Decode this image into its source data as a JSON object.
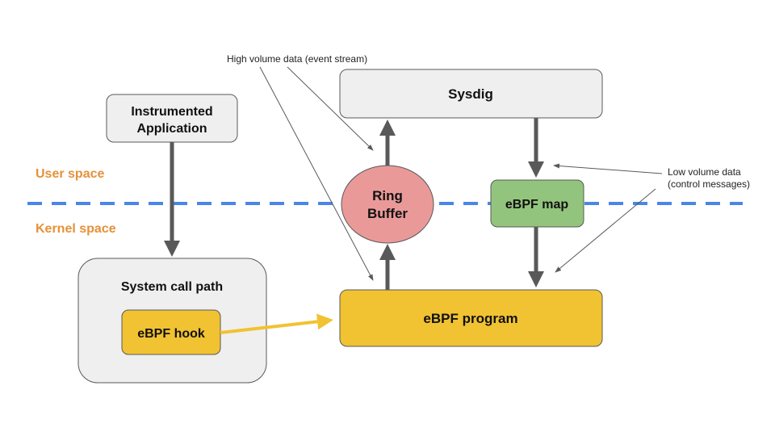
{
  "diagram": {
    "zones": {
      "user_space": "User space",
      "kernel_space": "Kernel space"
    },
    "nodes": {
      "sysdig": "Sysdig",
      "instrumented_app_line1": "Instrumented",
      "instrumented_app_line2": "Application",
      "ring_buffer_line1": "Ring",
      "ring_buffer_line2": "Buffer",
      "ebpf_map": "eBPF map",
      "system_call_path": "System call path",
      "ebpf_hook": "eBPF hook",
      "ebpf_program": "eBPF program"
    },
    "annotations": {
      "high_volume": "High volume data (event stream)",
      "low_volume_line1": "Low volume data",
      "low_volume_line2": "(control messages)"
    },
    "colors": {
      "gray_box": "#efefef",
      "ring_buffer": "#ea9999",
      "ebpf_map": "#93c47d",
      "ebpf_yellow": "#f1c232",
      "boundary_line": "#4a86e8",
      "zone_text": "#e69138",
      "arrow_dark": "#595959"
    },
    "edges": [
      {
        "from": "instrumented_app",
        "to": "system_call_path"
      },
      {
        "from": "ebpf_hook",
        "to": "ebpf_program"
      },
      {
        "from": "ebpf_program",
        "to": "ring_buffer"
      },
      {
        "from": "ring_buffer",
        "to": "sysdig"
      },
      {
        "from": "sysdig",
        "to": "ebpf_map"
      },
      {
        "from": "ebpf_map",
        "to": "ebpf_program"
      }
    ]
  }
}
